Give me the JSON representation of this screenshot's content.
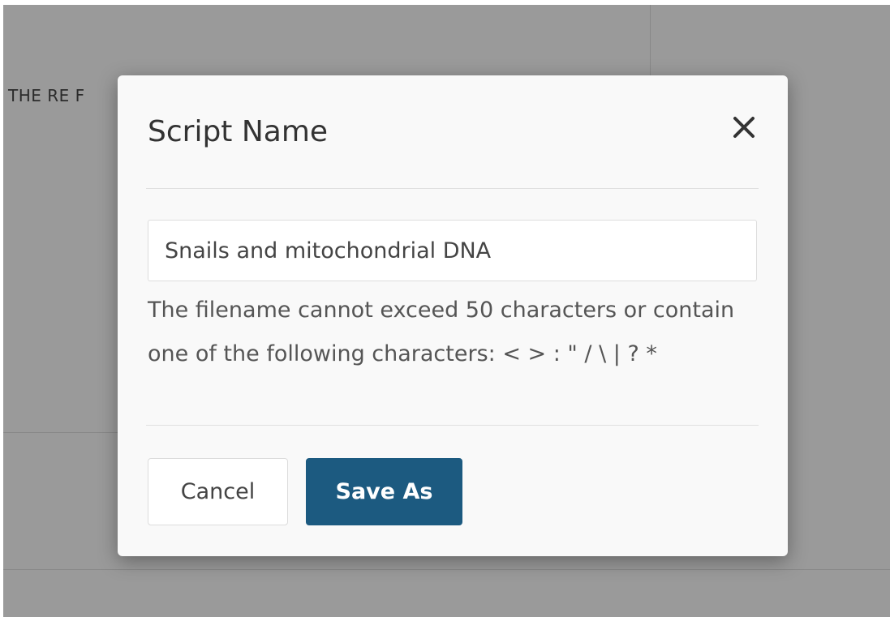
{
  "background": {
    "partial_text": "THE RE F"
  },
  "dialog": {
    "title": "Script Name",
    "close_icon": "close-icon",
    "input_value": "Snails and mitochondrial DNA",
    "help_text": "The filename cannot exceed 50 characters or contain one of the following characters: < > : \" / \\ | ? *",
    "cancel_label": "Cancel",
    "save_label": "Save As"
  },
  "colors": {
    "primary_button": "#1c5a80",
    "overlay": "#9a9a9a",
    "dialog_bg": "#f9f9f9"
  }
}
